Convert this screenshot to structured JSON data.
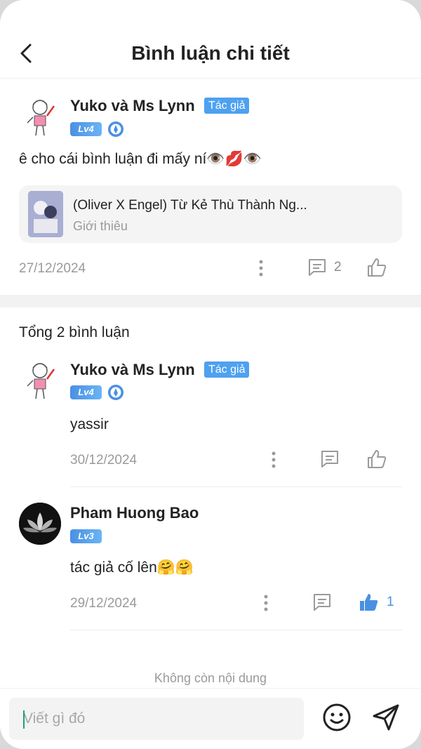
{
  "header": {
    "title": "Bình luận chi tiết"
  },
  "main_comment": {
    "author": "Yuko và Ms Lynn",
    "author_tag": "Tác giả",
    "level": "Lv4",
    "text": "ê cho cái bình luận đi mấy ní👁️💋👁️",
    "story": {
      "title": "(Oliver X Engel) Từ Kẻ Thù Thành Ng...",
      "subtitle": "Giới thiêu"
    },
    "date": "27/12/2024",
    "reply_count": "2"
  },
  "replies_total": "Tổng 2 bình luận",
  "replies": [
    {
      "author": "Yuko và Ms Lynn",
      "author_tag": "Tác giả",
      "level": "Lv4",
      "text": "yassir",
      "date": "30/12/2024"
    },
    {
      "author": "Pham Huong Bao",
      "level": "Lv3",
      "text": "tác giả cố lên🤗🤗",
      "date": "29/12/2024",
      "like_count": "1"
    }
  ],
  "end_text": "Không còn nội dung",
  "composer": {
    "placeholder": "Viết gì đó"
  },
  "colors": {
    "accent": "#4a90e2",
    "tag": "#4ea1f0",
    "muted": "#9a9a9a"
  }
}
